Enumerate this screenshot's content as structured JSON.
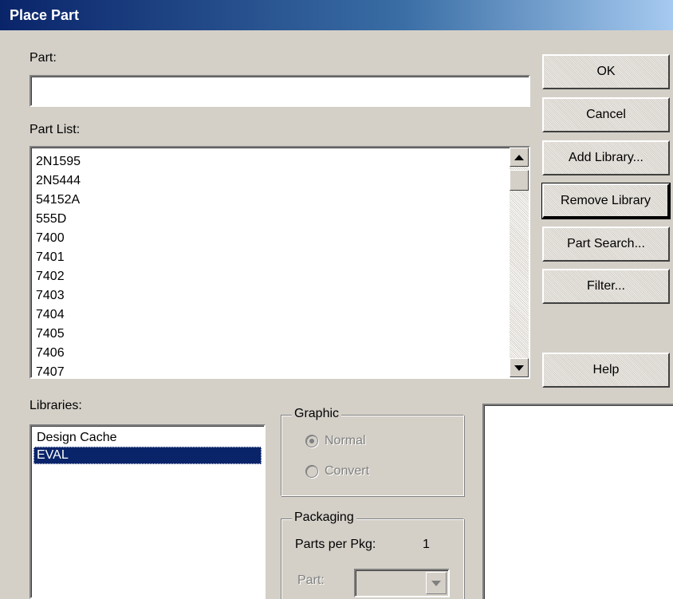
{
  "window": {
    "title": "Place Part"
  },
  "part_field": {
    "label": "Part:",
    "value": ""
  },
  "part_list": {
    "label": "Part List:",
    "items": [
      "2N1595",
      "2N5444",
      "54152A",
      "555D",
      "7400",
      "7401",
      "7402",
      "7403",
      "7404",
      "7405",
      "7406",
      "7407"
    ]
  },
  "buttons": {
    "ok": "OK",
    "cancel": "Cancel",
    "add_library": "Add Library...",
    "remove_library": "Remove Library",
    "part_search": "Part Search...",
    "filter": "Filter...",
    "help": "Help"
  },
  "libraries": {
    "label": "Libraries:",
    "items": [
      "Design Cache",
      "EVAL"
    ],
    "selected": "EVAL"
  },
  "graphic": {
    "title": "Graphic",
    "normal": "Normal",
    "convert": "Convert",
    "selected": "Normal"
  },
  "packaging": {
    "title": "Packaging",
    "parts_per_pkg_label": "Parts per Pkg:",
    "parts_per_pkg_value": "1",
    "part_label": "Part:",
    "part_value": ""
  },
  "colors": {
    "dialog_bg": "#d4d0c8",
    "title_start": "#0a246a",
    "title_end": "#a6caf0",
    "selection": "#0a246a"
  },
  "icons": {
    "scroll_up": "triangle-up-icon",
    "scroll_down": "triangle-down-icon",
    "combo_dropdown": "chevron-down-icon"
  }
}
